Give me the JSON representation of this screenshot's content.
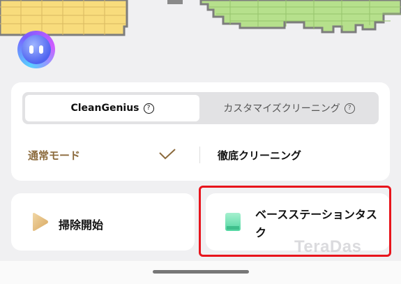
{
  "map": {
    "room_colors": {
      "yellow": "#f8dc7c",
      "green": "#b6e08c",
      "outline": "#7d7d7d"
    }
  },
  "mode_selector": {
    "tabs": [
      {
        "label": "CleanGenius",
        "active": true,
        "help_icon": "question-circle-icon"
      },
      {
        "label": "カスタマイズクリーニング",
        "active": false,
        "help_icon": "question-circle-icon"
      }
    ],
    "help_glyph": "?"
  },
  "cleaning_modes": {
    "left": {
      "label": "通常モード",
      "selected": true,
      "color": "#8b6a3c"
    },
    "right": {
      "label": "徹底クリーニング"
    }
  },
  "actions": {
    "start": {
      "label": "掃除開始",
      "icon": "play-icon"
    },
    "base_station": {
      "label": "ベースステーションタスク",
      "icon": "base-station-icon"
    }
  },
  "watermark": "TeraDas",
  "highlight_color": "#e8141c"
}
